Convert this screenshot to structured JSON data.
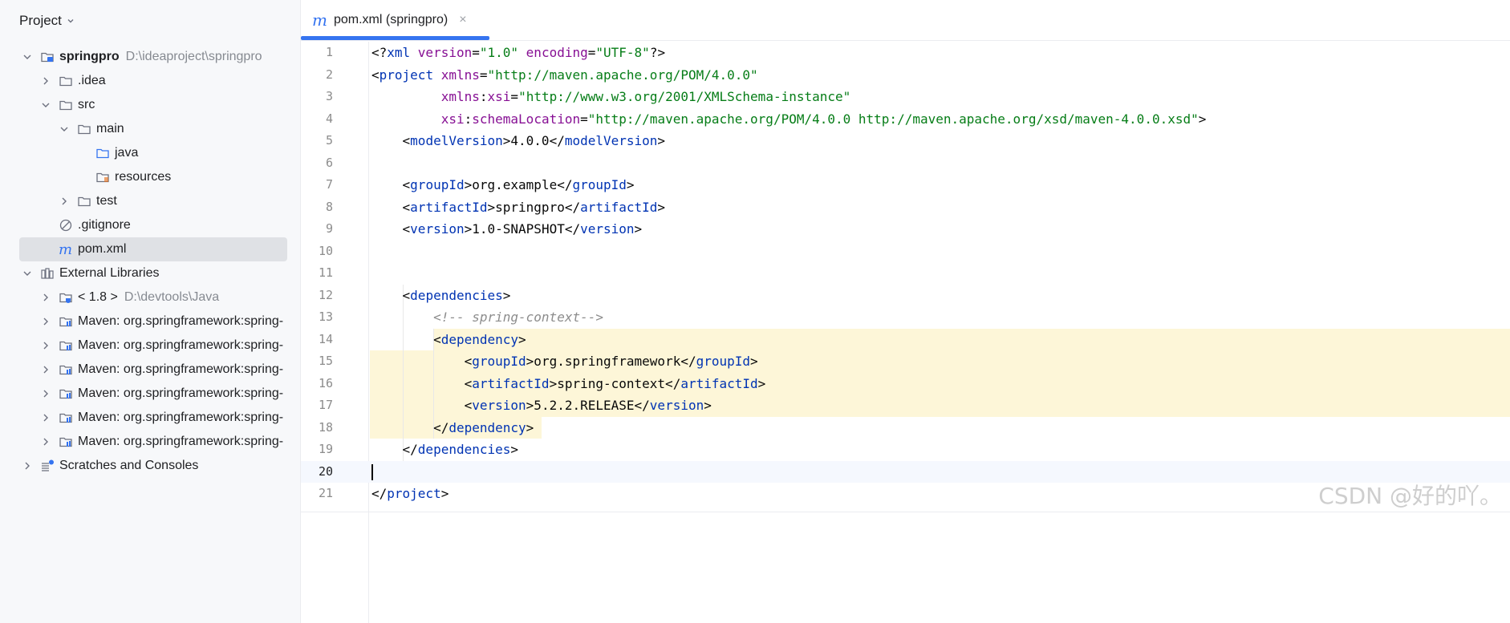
{
  "sidebar": {
    "title": "Project",
    "tree": [
      {
        "label": "springpro",
        "path": "D:\\ideaproject\\springpro",
        "bold": true,
        "icon": "module-folder-icon",
        "arrow": "down",
        "indent": 0
      },
      {
        "label": ".idea",
        "path": "",
        "icon": "folder-icon",
        "arrow": "right",
        "indent": 1
      },
      {
        "label": "src",
        "path": "",
        "icon": "folder-icon",
        "arrow": "down",
        "indent": 1
      },
      {
        "label": "main",
        "path": "",
        "icon": "folder-icon",
        "arrow": "down",
        "indent": 2
      },
      {
        "label": "java",
        "path": "",
        "icon": "source-folder-icon",
        "arrow": "",
        "indent": 3
      },
      {
        "label": "resources",
        "path": "",
        "icon": "resources-folder-icon",
        "arrow": "",
        "indent": 3
      },
      {
        "label": "test",
        "path": "",
        "icon": "folder-icon",
        "arrow": "right",
        "indent": 2
      },
      {
        "label": ".gitignore",
        "path": "",
        "icon": "ignore-file-icon",
        "arrow": "",
        "indent": 1
      },
      {
        "label": "pom.xml",
        "path": "",
        "icon": "maven-file-icon",
        "arrow": "",
        "indent": 1,
        "selected": true
      },
      {
        "label": "External Libraries",
        "path": "",
        "icon": "libraries-icon",
        "arrow": "down",
        "indent": 0
      },
      {
        "label": "< 1.8 >",
        "path": "D:\\devtools\\Java",
        "icon": "jdk-icon",
        "arrow": "right",
        "indent": 1
      },
      {
        "label": "Maven: org.springframework:spring-",
        "path": "",
        "icon": "maven-library-icon",
        "arrow": "right",
        "indent": 1
      },
      {
        "label": "Maven: org.springframework:spring-",
        "path": "",
        "icon": "maven-library-icon",
        "arrow": "right",
        "indent": 1
      },
      {
        "label": "Maven: org.springframework:spring-",
        "path": "",
        "icon": "maven-library-icon",
        "arrow": "right",
        "indent": 1
      },
      {
        "label": "Maven: org.springframework:spring-",
        "path": "",
        "icon": "maven-library-icon",
        "arrow": "right",
        "indent": 1
      },
      {
        "label": "Maven: org.springframework:spring-",
        "path": "",
        "icon": "maven-library-icon",
        "arrow": "right",
        "indent": 1
      },
      {
        "label": "Maven: org.springframework:spring-",
        "path": "",
        "icon": "maven-library-icon",
        "arrow": "right",
        "indent": 1
      },
      {
        "label": "Scratches and Consoles",
        "path": "",
        "icon": "scratches-icon",
        "arrow": "right",
        "indent": 0
      }
    ]
  },
  "editor": {
    "tab": {
      "icon_glyph": "m",
      "label": "pom.xml (springpro)",
      "close_glyph": "×"
    },
    "current_line": 20,
    "highlighted_lines": [
      14,
      15,
      16,
      17,
      18
    ],
    "lines": [
      {
        "n": "1",
        "tokens": [
          [
            "t-txt",
            "<?"
          ],
          [
            "t-tag",
            "xml "
          ],
          [
            "t-ns",
            "version"
          ],
          [
            "t-txt",
            "="
          ],
          [
            "t-str",
            "\"1.0\" "
          ],
          [
            "t-ns",
            "encoding"
          ],
          [
            "t-txt",
            "="
          ],
          [
            "t-str",
            "\"UTF-8\""
          ],
          [
            "t-txt",
            "?>"
          ]
        ]
      },
      {
        "n": "2",
        "tokens": [
          [
            "t-txt",
            "<"
          ],
          [
            "t-tag",
            "project "
          ],
          [
            "t-ns",
            "xmlns"
          ],
          [
            "t-txt",
            "="
          ],
          [
            "t-str",
            "\"http://maven.apache.org/POM/4.0.0\""
          ]
        ]
      },
      {
        "n": "3",
        "tokens": [
          [
            "t-txt",
            "         "
          ],
          [
            "t-ns",
            "xmlns"
          ],
          [
            "t-txt",
            ":"
          ],
          [
            "t-ns",
            "xsi"
          ],
          [
            "t-txt",
            "="
          ],
          [
            "t-str",
            "\"http://www.w3.org/2001/XMLSchema-instance\""
          ]
        ]
      },
      {
        "n": "4",
        "tokens": [
          [
            "t-txt",
            "         "
          ],
          [
            "t-ns",
            "xsi"
          ],
          [
            "t-txt",
            ":"
          ],
          [
            "t-ns",
            "schemaLocation"
          ],
          [
            "t-txt",
            "="
          ],
          [
            "t-str",
            "\"http://maven.apache.org/POM/4.0.0 http://maven.apache.org/xsd/maven-4.0.0.xsd\""
          ],
          [
            "t-txt",
            ">"
          ]
        ]
      },
      {
        "n": "5",
        "tokens": [
          [
            "t-txt",
            "    <"
          ],
          [
            "t-tag",
            "modelVersion"
          ],
          [
            "t-txt",
            ">4.0.0</"
          ],
          [
            "t-tag",
            "modelVersion"
          ],
          [
            "t-txt",
            ">"
          ]
        ]
      },
      {
        "n": "6",
        "tokens": []
      },
      {
        "n": "7",
        "tokens": [
          [
            "t-txt",
            "    <"
          ],
          [
            "t-tag",
            "groupId"
          ],
          [
            "t-txt",
            ">org.example</"
          ],
          [
            "t-tag",
            "groupId"
          ],
          [
            "t-txt",
            ">"
          ]
        ]
      },
      {
        "n": "8",
        "tokens": [
          [
            "t-txt",
            "    <"
          ],
          [
            "t-tag",
            "artifactId"
          ],
          [
            "t-txt",
            ">springpro</"
          ],
          [
            "t-tag",
            "artifactId"
          ],
          [
            "t-txt",
            ">"
          ]
        ]
      },
      {
        "n": "9",
        "tokens": [
          [
            "t-txt",
            "    <"
          ],
          [
            "t-tag",
            "version"
          ],
          [
            "t-txt",
            ">1.0-SNAPSHOT</"
          ],
          [
            "t-tag",
            "version"
          ],
          [
            "t-txt",
            ">"
          ]
        ]
      },
      {
        "n": "10",
        "tokens": []
      },
      {
        "n": "11",
        "tokens": []
      },
      {
        "n": "12",
        "tokens": [
          [
            "t-txt",
            "    <"
          ],
          [
            "t-tag",
            "dependencies"
          ],
          [
            "t-txt",
            ">"
          ]
        ]
      },
      {
        "n": "13",
        "tokens": [
          [
            "t-txt",
            "        "
          ],
          [
            "t-cmt",
            "<!-- spring-context-->"
          ]
        ]
      },
      {
        "n": "14",
        "tokens": [
          [
            "t-txt",
            "        <"
          ],
          [
            "t-tag",
            "dependency"
          ],
          [
            "t-txt",
            ">"
          ]
        ]
      },
      {
        "n": "15",
        "tokens": [
          [
            "t-txt",
            "            <"
          ],
          [
            "t-tag",
            "groupId"
          ],
          [
            "t-txt",
            ">org.springframework</"
          ],
          [
            "t-tag",
            "groupId"
          ],
          [
            "t-txt",
            ">"
          ]
        ]
      },
      {
        "n": "16",
        "tokens": [
          [
            "t-txt",
            "            <"
          ],
          [
            "t-tag",
            "artifactId"
          ],
          [
            "t-txt",
            ">spring-context</"
          ],
          [
            "t-tag",
            "artifactId"
          ],
          [
            "t-txt",
            ">"
          ]
        ]
      },
      {
        "n": "17",
        "tokens": [
          [
            "t-txt",
            "            <"
          ],
          [
            "t-tag",
            "version"
          ],
          [
            "t-txt",
            ">5.2.2.RELEASE</"
          ],
          [
            "t-tag",
            "version"
          ],
          [
            "t-txt",
            ">"
          ]
        ]
      },
      {
        "n": "18",
        "tokens": [
          [
            "t-txt",
            "        </"
          ],
          [
            "t-tag",
            "dependency"
          ],
          [
            "t-txt",
            ">"
          ]
        ]
      },
      {
        "n": "19",
        "tokens": [
          [
            "t-txt",
            "    </"
          ],
          [
            "t-tag",
            "dependencies"
          ],
          [
            "t-txt",
            ">"
          ]
        ]
      },
      {
        "n": "20",
        "tokens": []
      },
      {
        "n": "21",
        "tokens": [
          [
            "t-txt",
            "</"
          ],
          [
            "t-tag",
            "project"
          ],
          [
            "t-txt",
            ">"
          ]
        ]
      }
    ]
  },
  "watermark": "CSDN @好的吖。",
  "colors": {
    "accent": "#3574f0",
    "selection": "#dfe1e5",
    "highlight": "#fdf6d8",
    "tag": "#0033b3",
    "attr": "#871094",
    "string": "#067d17",
    "comment": "#8c8c8c"
  }
}
